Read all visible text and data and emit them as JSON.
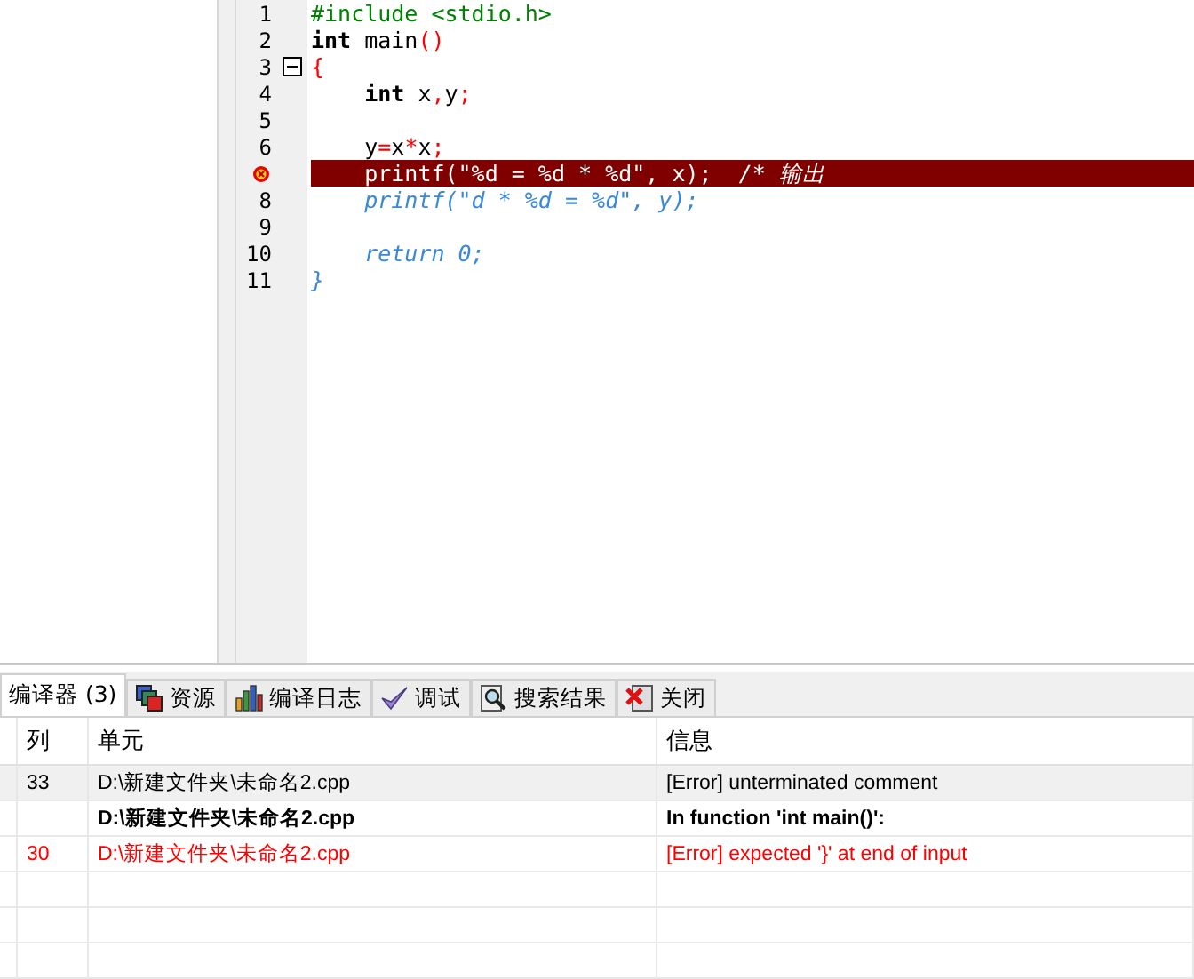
{
  "editor": {
    "lines": [
      {
        "number": "1",
        "tokens": [
          {
            "kind": "preproc",
            "text": "#include <stdio.h>"
          }
        ]
      },
      {
        "number": "2",
        "tokens": [
          {
            "kind": "keyword",
            "text": "int"
          },
          {
            "kind": "plain",
            "text": " main"
          },
          {
            "kind": "symbol",
            "text": "()"
          }
        ]
      },
      {
        "number": "3",
        "fold": true,
        "tokens": [
          {
            "kind": "symbol",
            "text": "{"
          }
        ]
      },
      {
        "number": "4",
        "tokens": [
          {
            "kind": "keyword",
            "text": "    int"
          },
          {
            "kind": "plain",
            "text": " x"
          },
          {
            "kind": "symbol",
            "text": ","
          },
          {
            "kind": "plain",
            "text": "y"
          },
          {
            "kind": "symbol",
            "text": ";"
          }
        ]
      },
      {
        "number": "5"
      },
      {
        "number": "6",
        "tokens": [
          {
            "kind": "plain",
            "text": "    y"
          },
          {
            "kind": "symbol",
            "text": "="
          },
          {
            "kind": "plain",
            "text": "x"
          },
          {
            "kind": "symbol",
            "text": "*"
          },
          {
            "kind": "plain",
            "text": "x"
          },
          {
            "kind": "symbol",
            "text": ";"
          }
        ]
      },
      {
        "error": true,
        "tokens": [
          {
            "kind": "plain",
            "text": "    printf(\"%d = %d * %d\", x);  "
          },
          {
            "kind": "comment",
            "text": "/* 输出"
          }
        ]
      },
      {
        "number": "8",
        "tokens": [
          {
            "kind": "comment",
            "text": "    printf(\"d * %d = %d\", y);"
          }
        ]
      },
      {
        "number": "9"
      },
      {
        "number": "10",
        "tokens": [
          {
            "kind": "comment",
            "text": "    return 0;"
          }
        ]
      },
      {
        "number": "11",
        "tokens": [
          {
            "kind": "comment",
            "text": "}"
          }
        ]
      }
    ]
  },
  "tabs": [
    {
      "label": "编译器 (3)",
      "selected": true
    },
    {
      "label": "资源",
      "selected": false
    },
    {
      "label": "编译日志",
      "selected": false
    },
    {
      "label": "调试",
      "selected": false
    },
    {
      "label": "搜索结果",
      "selected": false
    },
    {
      "label": "关闭",
      "selected": false
    }
  ],
  "table": {
    "columns": [
      "列",
      "单元",
      "信息"
    ],
    "rows": [
      {
        "kind": "plain",
        "selected": true,
        "column": "33",
        "unit": "D:\\新建文件夹\\未命名2.cpp",
        "message": "[Error] unterminated comment"
      },
      {
        "kind": "bold",
        "selected": false,
        "column": "",
        "unit": "D:\\新建文件夹\\未命名2.cpp",
        "message": "In function 'int main()':"
      },
      {
        "kind": "error",
        "selected": false,
        "column": "30",
        "unit": "D:\\新建文件夹\\未命名2.cpp",
        "message": "[Error] expected '}' at end of input"
      }
    ]
  }
}
